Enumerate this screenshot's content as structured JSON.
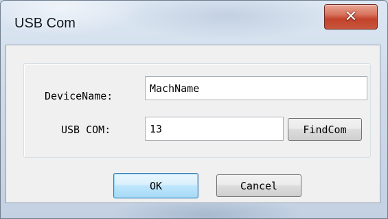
{
  "window": {
    "title": "USB Com",
    "close_icon": "close-x-icon",
    "accent_close_color": "#c8553d"
  },
  "form": {
    "device_name_label": "DeviceName:",
    "device_name_value": "MachName",
    "usb_com_label": "USB COM:",
    "usb_com_value": "13",
    "find_com_label": "FindCom"
  },
  "buttons": {
    "ok_label": "OK",
    "cancel_label": "Cancel"
  }
}
